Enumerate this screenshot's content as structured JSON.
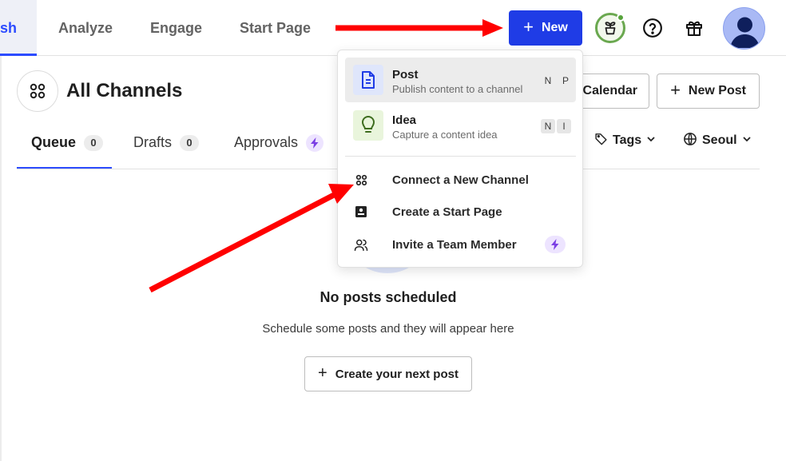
{
  "topnav": {
    "tabs": [
      {
        "label": "sh",
        "active": true
      },
      {
        "label": "Analyze",
        "active": false
      },
      {
        "label": "Engage",
        "active": false
      },
      {
        "label": "Start Page",
        "active": false
      }
    ],
    "new_button": {
      "label": "New",
      "icon": "plus-icon"
    },
    "icons": [
      "plant-icon",
      "help-icon",
      "gift-icon"
    ],
    "avatar_icon": "user-avatar-icon"
  },
  "header": {
    "channels_icon": "channels-grid-icon",
    "title": "All Channels",
    "calendar_label": "Calendar",
    "new_post_label": "New Post"
  },
  "subtabs": [
    {
      "label": "Queue",
      "count": "0",
      "active": true
    },
    {
      "label": "Drafts",
      "count": "0",
      "active": false
    },
    {
      "label": "Approvals",
      "badge": "bolt-icon",
      "active": false
    }
  ],
  "filters": {
    "tags_label": "Tags",
    "timezone_label": "Seoul"
  },
  "empty_state": {
    "title": "No posts scheduled",
    "subtitle": "Schedule some posts and they will appear here",
    "button_label": "Create your next post"
  },
  "dropdown": {
    "items": [
      {
        "title": "Post",
        "description": "Publish content to a channel",
        "shortcut": [
          "N",
          "P"
        ],
        "icon": "document-icon"
      },
      {
        "title": "Idea",
        "description": "Capture a content idea",
        "shortcut": [
          "N",
          "I"
        ],
        "icon": "lightbulb-icon"
      }
    ],
    "actions": [
      {
        "label": "Connect a New Channel",
        "icon": "channels-grid-icon"
      },
      {
        "label": "Create a Start Page",
        "icon": "start-page-icon"
      },
      {
        "label": "Invite a Team Member",
        "icon": "team-icon",
        "badge": "bolt-icon"
      }
    ]
  },
  "colors": {
    "primary": "#1f3ce6",
    "annotation_arrow": "#ff0000",
    "bolt": "#7b3fe4"
  }
}
